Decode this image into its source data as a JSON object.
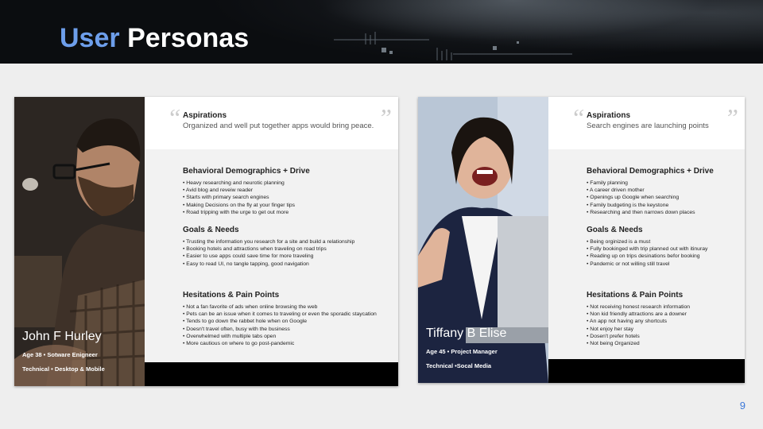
{
  "slide": {
    "title_part1": "User",
    "title_part2": "Personas",
    "page_number": "9"
  },
  "personas": [
    {
      "name": "John F Hurley",
      "age_role": "Age 38 • Sotware Enigneer",
      "tech": "Technical • Desktop & Mobile",
      "aspirations_heading": "Aspirations",
      "aspirations_text": "Organized and well put together apps would bring peace.",
      "sections": [
        {
          "heading": "Behavioral Demographics + Drive",
          "items": [
            "Heavy researching and neurotic planning",
            "Avid blog and reveiw reader",
            "Starts with primary search engines",
            "Making Decisions on the fly at your finger tips",
            "Road tripping with the urge to get out more"
          ]
        },
        {
          "heading": "Goals & Needs",
          "items": [
            "Trusting the information you research for a site and build a relationship",
            "Booking hotels and attractions when traveling on road trips",
            "Easier to use apps could save time for more traveling",
            "Easy to read UI, no tangle tapping, good navigation"
          ]
        },
        {
          "heading": "Hesitations & Pain Points",
          "items": [
            "Not a fan favorite of ads  when online browsing the web",
            "Pets can be an issue when it comes to traveling or even the sporadic staycation",
            "Tends to go down the rabbet hole when on Google",
            "Doesn't travel often, busy with the business",
            "Overwhelmed with multiple tabs open",
            "More cautious on where to go post-pandemic"
          ]
        }
      ]
    },
    {
      "name": "Tiffany B Elise",
      "age_role": "Age 45 • Project Manager",
      "tech": "Technical •Socal Media",
      "aspirations_heading": "Aspirations",
      "aspirations_text": "Search engines are launching points",
      "sections": [
        {
          "heading": "Behavioral Demographics + Drive",
          "items": [
            "Family planning",
            "A career driven mother",
            "Openings up Google when searching",
            "Family budgeting is the keystone",
            "Researching and then narrows down places"
          ]
        },
        {
          "heading": "Goals & Needs",
          "items": [
            "Being orginized is a must",
            "Fully bookinged with trip planned out with itinuray",
            "Reading up on trips desinations befor booking",
            "Pandemic or not willing still travel"
          ]
        },
        {
          "heading": "Hesitations & Pain Points",
          "items": [
            "Not receiving honest research information",
            "Non kid friendly attractions are a downer",
            "An app not having any shortcuts",
            "Not enjoy her stay",
            "Dosen't prefer hotels",
            "Not being Organized"
          ]
        }
      ]
    }
  ],
  "colors": {
    "title_accent": "#6d9eeb",
    "title_main": "#ffffff",
    "header_bg": "#0b0d10",
    "page_bg": "#eeeeee",
    "page_number": "#3c78d8"
  }
}
